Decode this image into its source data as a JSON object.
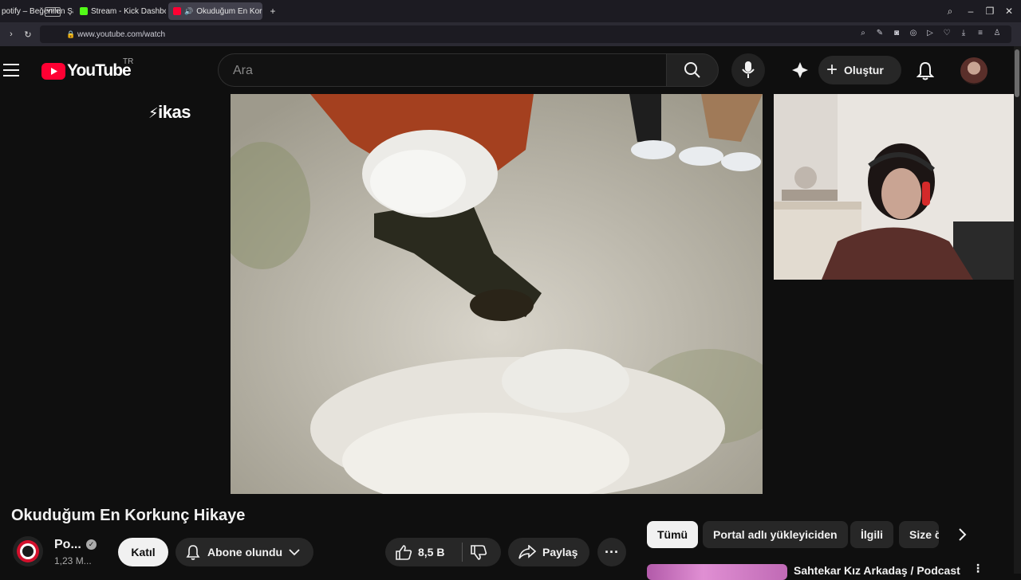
{
  "browser": {
    "tabs": [
      {
        "label": "potify – Beğenilen Şarkıl",
        "fav_color": "#1db954"
      },
      {
        "label": "Stream - Kick Dashboard",
        "fav_color": "#53fc18"
      },
      {
        "label": "Okuduğum En Korkunç",
        "fav_color": "#ff0033"
      }
    ],
    "url": "www.youtube.com/watch",
    "vpn_label": "VPN"
  },
  "youtube": {
    "logo_text": "YouTube",
    "region": "TR",
    "search_placeholder": "Ara",
    "create_label": "Oluştur"
  },
  "ad": {
    "brand": "ikas"
  },
  "video": {
    "title": "Okuduğum En Korkunç Hikaye",
    "channel_name": "Po...",
    "channel_subs": "1,23 M...",
    "join_label": "Katıl",
    "subscribed_label": "Abone olundu",
    "likes": "8,5 B",
    "share_label": "Paylaş"
  },
  "chips": [
    "Tümü",
    "Portal adlı yükleyiciden",
    "İlgili",
    "Size ö"
  ],
  "suggestion": {
    "title": "Sahtekar Kız Arkadaş / Podcast"
  },
  "colors": {
    "accent": "#ff0033",
    "bg": "#0f0f0f"
  }
}
